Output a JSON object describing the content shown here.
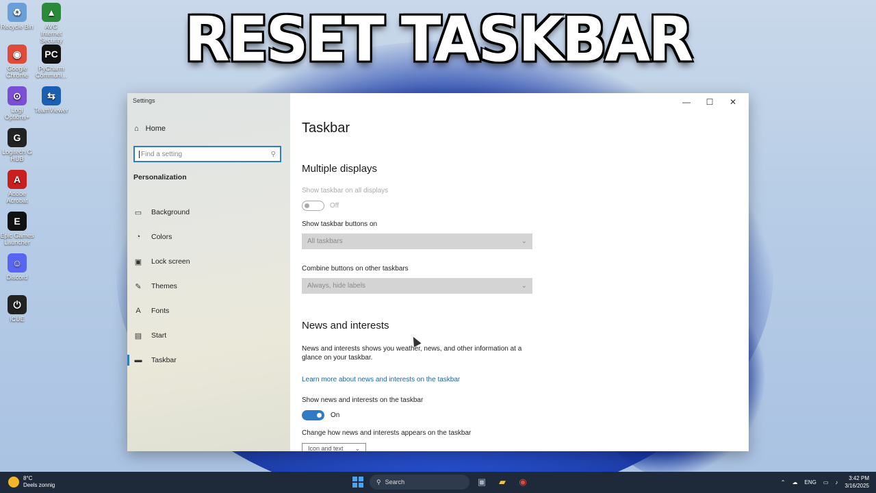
{
  "headline": "RESET TASKBAR",
  "desktop_icons": [
    {
      "label": "Recycle Bin",
      "icon": "recycle-bin-icon",
      "glyph": "♻",
      "color": "#6aa0d8"
    },
    {
      "label": "AVG Internet Security",
      "icon": "avg-icon",
      "glyph": "▲",
      "color": "#2a8a3a"
    },
    {
      "label": "Google Chrome",
      "icon": "chrome-icon",
      "glyph": "◉",
      "color": "#e04a3b"
    },
    {
      "label": "PyCharm Communi...",
      "icon": "pycharm-icon",
      "glyph": "PC",
      "color": "#111111"
    },
    {
      "label": "Logi Options+",
      "icon": "logi-options-icon",
      "glyph": "⊙",
      "color": "#7a4fd6"
    },
    {
      "label": "TeamViewer",
      "icon": "teamviewer-icon",
      "glyph": "⇆",
      "color": "#1b5fb3"
    },
    {
      "label": "Logitech G HUB",
      "icon": "logitech-ghub-icon",
      "glyph": "G",
      "color": "#222222"
    },
    {
      "label": "Adobe Acrobat",
      "icon": "adobe-acrobat-icon",
      "glyph": "A",
      "color": "#c8201f"
    },
    {
      "label": "Epic Games Launcher",
      "icon": "epic-games-icon",
      "glyph": "E",
      "color": "#111111"
    },
    {
      "label": "Discord",
      "icon": "discord-icon",
      "glyph": "☺",
      "color": "#5865f2"
    },
    {
      "label": "iCUE",
      "icon": "icue-icon",
      "glyph": "⏻",
      "color": "#222222"
    }
  ],
  "settings": {
    "window_title": "Settings",
    "home": "Home",
    "search_placeholder": "Find a setting",
    "section": "Personalization",
    "nav": [
      {
        "label": "Background",
        "icon": "background-icon",
        "glyph": "▭"
      },
      {
        "label": "Colors",
        "icon": "colors-icon",
        "glyph": "◔"
      },
      {
        "label": "Lock screen",
        "icon": "lock-screen-icon",
        "glyph": "▣"
      },
      {
        "label": "Themes",
        "icon": "themes-icon",
        "glyph": "✎"
      },
      {
        "label": "Fonts",
        "icon": "fonts-icon",
        "glyph": "A"
      },
      {
        "label": "Start",
        "icon": "start-icon",
        "glyph": "▤"
      },
      {
        "label": "Taskbar",
        "icon": "taskbar-icon",
        "glyph": "▬",
        "active": true
      }
    ],
    "page_title": "Taskbar",
    "multiple_displays": {
      "heading": "Multiple displays",
      "show_all_label": "Show taskbar on all displays",
      "show_all_state": "Off",
      "buttons_on_label": "Show taskbar buttons on",
      "buttons_on_value": "All taskbars",
      "combine_label": "Combine buttons on other taskbars",
      "combine_value": "Always, hide labels"
    },
    "news": {
      "heading": "News and interests",
      "description": "News and interests shows you weather, news, and other information at a glance on your taskbar.",
      "link": "Learn more about news and interests on the taskbar",
      "show_label": "Show news and interests on the taskbar",
      "show_state": "On",
      "change_label": "Change how news and interests appears on the taskbar",
      "change_value": "Icon and text"
    }
  },
  "taskbar": {
    "weather_temp": "8°C",
    "weather_desc": "Deels zonnig",
    "search_label": "Search",
    "language": "ENG",
    "time": "3:42 PM",
    "date": "3/16/2025"
  }
}
